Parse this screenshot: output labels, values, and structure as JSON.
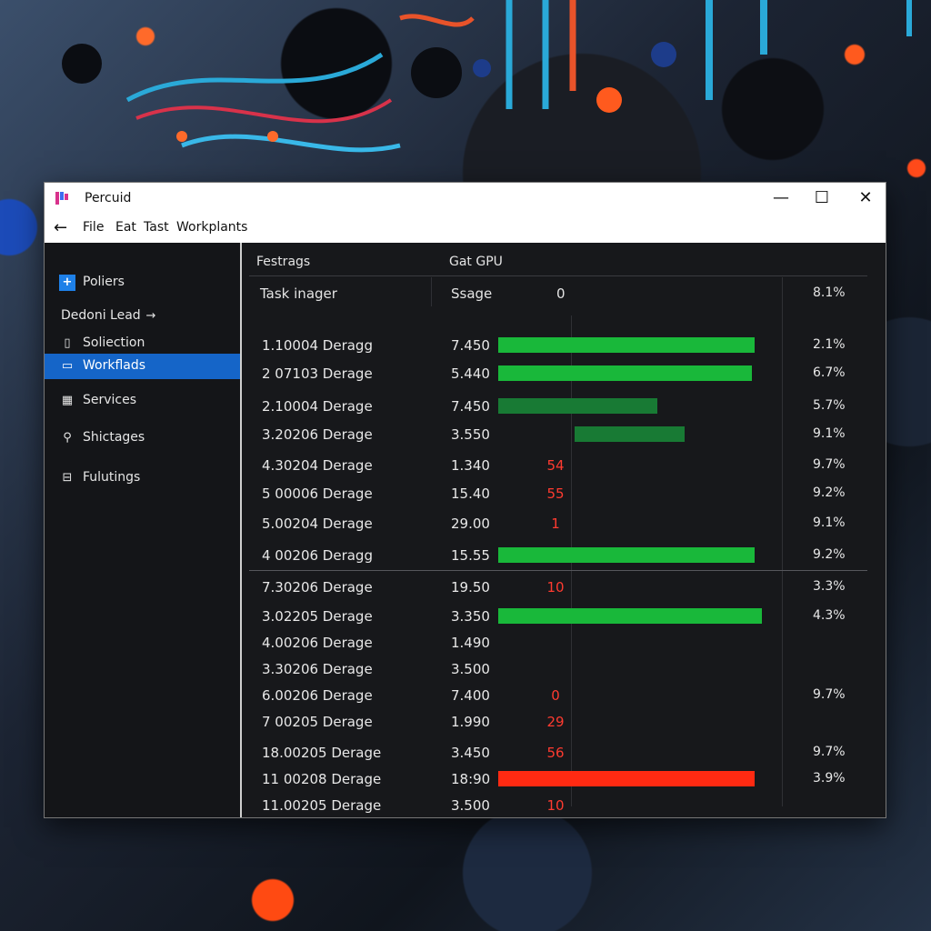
{
  "window": {
    "title": "Percuid",
    "controls": {
      "minimize": "—",
      "maximize": "☐",
      "close": "✕"
    }
  },
  "menu": {
    "back": "←",
    "items": [
      "File",
      "Eat",
      "Tast",
      "Workplants"
    ]
  },
  "sidebar": {
    "items": [
      {
        "label": "Poliers",
        "icon": "plus-icon",
        "glyph": "+"
      },
      {
        "label": "Dedoni Lead",
        "icon": "arrow-right-icon",
        "glyph": "→"
      },
      {
        "label": "Soliection",
        "icon": "document-icon",
        "glyph": "▯"
      },
      {
        "label": "Workflads",
        "icon": "monitor-icon",
        "glyph": "▭",
        "active": true
      },
      {
        "label": "Services",
        "icon": "grid-icon",
        "glyph": "▦"
      },
      {
        "label": "Shictages",
        "icon": "link-icon",
        "glyph": "⚲"
      },
      {
        "label": "Fulutings",
        "icon": "display-icon",
        "glyph": "⊟"
      }
    ]
  },
  "table": {
    "header_row1": {
      "col1": "Festrags",
      "col2": "Gat GPU"
    },
    "header_row2": {
      "col1": "Task inager",
      "col2": "Ssage",
      "col3": "0",
      "col4": "8.1%"
    },
    "rows": [
      {
        "name": "1.10004 Deragg",
        "value": "7.450",
        "num": "",
        "bar": 1.0,
        "bar_color": "#19b83a",
        "pct": "2.1%"
      },
      {
        "name": "2 07103 Derage",
        "value": "5.440",
        "num": "",
        "bar": 0.99,
        "bar_color": "#19b83a",
        "pct": "6.7%"
      },
      {
        "name": "2.10004 Derage",
        "value": "7.450",
        "num": "",
        "bar": 0.62,
        "bar_color": "#187a34",
        "pct": "5.7%"
      },
      {
        "name": "3.20206 Derage",
        "value": "3.550",
        "num": "",
        "bar": 0.43,
        "bar_color": "#187a34",
        "pct": "9.1%"
      },
      {
        "name": "4.30204 Derage",
        "value": "1.340",
        "num": "54",
        "bar": 0,
        "bar_color": "",
        "pct": "9.7%"
      },
      {
        "name": "5 00006 Derage",
        "value": "15.40",
        "num": "55",
        "bar": 0,
        "bar_color": "",
        "pct": "9.2%"
      },
      {
        "name": "5.00204 Derage",
        "value": "29.00",
        "num": "1",
        "bar": 0,
        "bar_color": "",
        "pct": "9.1%"
      },
      {
        "name": "4 00206 Deragg",
        "value": "15.55",
        "num": "",
        "bar": 1.0,
        "bar_color": "#19b83a",
        "pct": "9.2%"
      },
      {
        "name": "7.30206 Derage",
        "value": "19.50",
        "num": "10",
        "bar": 0,
        "bar_color": "",
        "pct": "3.3%"
      },
      {
        "name": "3.02205 Derage",
        "value": "3.350",
        "num": "",
        "bar": 1.03,
        "bar_color": "#19b83a",
        "pct": "4.3%"
      },
      {
        "name": "4.00206 Derage",
        "value": "1.490",
        "num": "",
        "bar": 0,
        "bar_color": "",
        "pct": ""
      },
      {
        "name": "3.30206 Derage",
        "value": "3.500",
        "num": "",
        "bar": 0,
        "bar_color": "",
        "pct": ""
      },
      {
        "name": "6.00206 Derage",
        "value": "7.400",
        "num": "0",
        "bar": 0,
        "bar_color": "",
        "pct": "9.7%"
      },
      {
        "name": "7 00205 Derage",
        "value": "1.990",
        "num": "29",
        "bar": 0,
        "bar_color": "",
        "pct": ""
      },
      {
        "name": "18.00205 Derage",
        "value": "3.450",
        "num": "56",
        "bar": 0,
        "bar_color": "",
        "pct": "9.7%"
      },
      {
        "name": "11 00208 Derage",
        "value": "18:90",
        "num": "",
        "bar": 1.0,
        "bar_color": "#ff2a12",
        "pct": "3.9%"
      },
      {
        "name": "11.00205 Derage",
        "value": "3.500",
        "num": "10",
        "bar": 0,
        "bar_color": "",
        "pct": ""
      }
    ]
  }
}
